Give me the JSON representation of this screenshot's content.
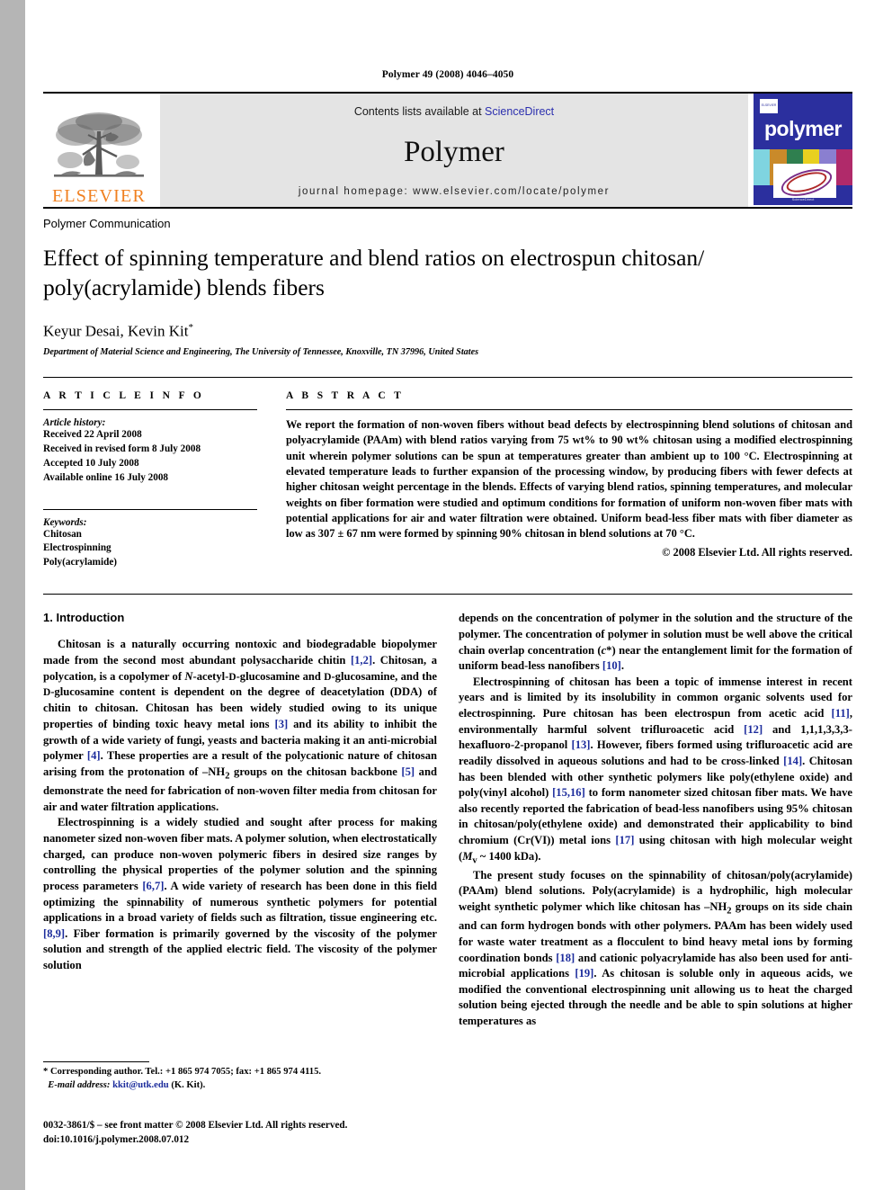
{
  "running_head": "Polymer 49 (2008) 4046–4050",
  "masthead": {
    "publisher_name": "ELSEVIER",
    "contents_prefix": "Contents lists available at ",
    "contents_link": "ScienceDirect",
    "journal_title": "Polymer",
    "homepage": "journal homepage: www.elsevier.com/locate/polymer",
    "cover_word": "polymer",
    "cover_badge": "ELSEVIER",
    "cover_footer": "ScienceDirect"
  },
  "article": {
    "category": "Polymer Communication",
    "title_line1": "Effect of spinning temperature and blend ratios on electrospun chitosan/",
    "title_line2": "poly(acrylamide) blends fibers",
    "authors": "Keyur Desai, Kevin Kit",
    "author_marker": "*",
    "affiliation": "Department of Material Science and Engineering, The University of Tennessee, Knoxville, TN 37996, United States"
  },
  "article_info": {
    "heading": "A R T I C L E  I N F O",
    "history_label": "Article history:",
    "history": [
      "Received 22 April 2008",
      "Received in revised form 8 July 2008",
      "Accepted 10 July 2008",
      "Available online 16 July 2008"
    ],
    "keywords_label": "Keywords:",
    "keywords": [
      "Chitosan",
      "Electrospinning",
      "Poly(acrylamide)"
    ]
  },
  "abstract": {
    "heading": "A B S T R A C T",
    "text": "We report the formation of non-woven fibers without bead defects by electrospinning blend solutions of chitosan and polyacrylamide (PAAm) with blend ratios varying from 75 wt% to 90 wt% chitosan using a modified electrospinning unit wherein polymer solutions can be spun at temperatures greater than ambient up to 100 °C. Electrospinning at elevated temperature leads to further expansion of the processing window, by producing fibers with fewer defects at higher chitosan weight percentage in the blends. Effects of varying blend ratios, spinning temperatures, and molecular weights on fiber formation were studied and optimum conditions for formation of uniform non-woven fiber mats with potential applications for air and water filtration were obtained. Uniform bead-less fiber mats with fiber diameter as low as 307 ± 67 nm were formed by spinning 90% chitosan in blend solutions at 70 °C.",
    "copyright": "© 2008 Elsevier Ltd. All rights reserved."
  },
  "body": {
    "section_heading": "1. Introduction",
    "left_paragraphs": [
      "Chitosan is a naturally occurring nontoxic and biodegradable biopolymer made from the second most abundant polysaccharide chitin [1,2]. Chitosan, a polycation, is a copolymer of N-acetyl-D-glucosamine and D-glucosamine, and the D-glucosamine content is dependent on the degree of deacetylation (DDA) of chitin to chitosan. Chitosan has been widely studied owing to its unique properties of binding toxic heavy metal ions [3] and its ability to inhibit the growth of a wide variety of fungi, yeasts and bacteria making it an anti-microbial polymer [4]. These properties are a result of the polycationic nature of chitosan arising from the protonation of –NH2 groups on the chitosan backbone [5] and demonstrate the need for fabrication of non-woven filter media from chitosan for air and water filtration applications.",
      "Electrospinning is a widely studied and sought after process for making nanometer sized non-woven fiber mats. A polymer solution, when electrostatically charged, can produce non-woven polymeric fibers in desired size ranges by controlling the physical properties of the polymer solution and the spinning process parameters [6,7]. A wide variety of research has been done in this field optimizing the spinnability of numerous synthetic polymers for potential applications in a broad variety of fields such as filtration, tissue engineering etc. [8,9]. Fiber formation is primarily governed by the viscosity of the polymer solution and strength of the applied electric field. The viscosity of the polymer solution"
    ],
    "right_paragraphs": [
      "depends on the concentration of polymer in the solution and the structure of the polymer. The concentration of polymer in solution must be well above the critical chain overlap concentration (c*) near the entanglement limit for the formation of uniform bead-less nanofibers [10].",
      "Electrospinning of chitosan has been a topic of immense interest in recent years and is limited by its insolubility in common organic solvents used for electrospinning. Pure chitosan has been electrospun from acetic acid [11], environmentally harmful solvent trifluroacetic acid [12] and 1,1,1,3,3,3-hexafluoro-2-propanol [13]. However, fibers formed using trifluroacetic acid are readily dissolved in aqueous solutions and had to be cross-linked [14]. Chitosan has been blended with other synthetic polymers like poly(ethylene oxide) and poly(vinyl alcohol) [15,16] to form nanometer sized chitosan fiber mats. We have also recently reported the fabrication of bead-less nanofibers using 95% chitosan in chitosan/poly(ethylene oxide) and demonstrated their applicability to bind chromium (Cr(VI)) metal ions [17] using chitosan with high molecular weight (Mv ~ 1400 kDa).",
      "The present study focuses on the spinnability of chitosan/poly(acrylamide) (PAAm) blend solutions. Poly(acrylamide) is a hydrophilic, high molecular weight synthetic polymer which like chitosan has –NH2 groups on its side chain and can form hydrogen bonds with other polymers. PAAm has been widely used for waste water treatment as a flocculent to bind heavy metal ions by forming coordination bonds [18] and cationic polyacrylamide has also been used for anti-microbial applications [19]. As chitosan is soluble only in aqueous acids, we modified the conventional electrospinning unit allowing us to heat the charged solution being ejected through the needle and be able to spin solutions at higher temperatures as"
    ]
  },
  "footnotes": {
    "corresponding": "* Corresponding author. Tel.: +1 865 974 7055; fax: +1 865 974 4115.",
    "email_label": "E-mail address:",
    "email": "kkit@utk.edu",
    "email_suffix": "(K. Kit)."
  },
  "imprint": {
    "line1": "0032-3861/$ – see front matter © 2008 Elsevier Ltd. All rights reserved.",
    "line2": "doi:10.1016/j.polymer.2008.07.012"
  },
  "colors": {
    "link": "#2b2fae",
    "reference": "#1c2c9c",
    "elsevier_orange": "#f08020",
    "cover_blue": "#2b2f9e",
    "banner_gray": "#e4e4e4"
  }
}
